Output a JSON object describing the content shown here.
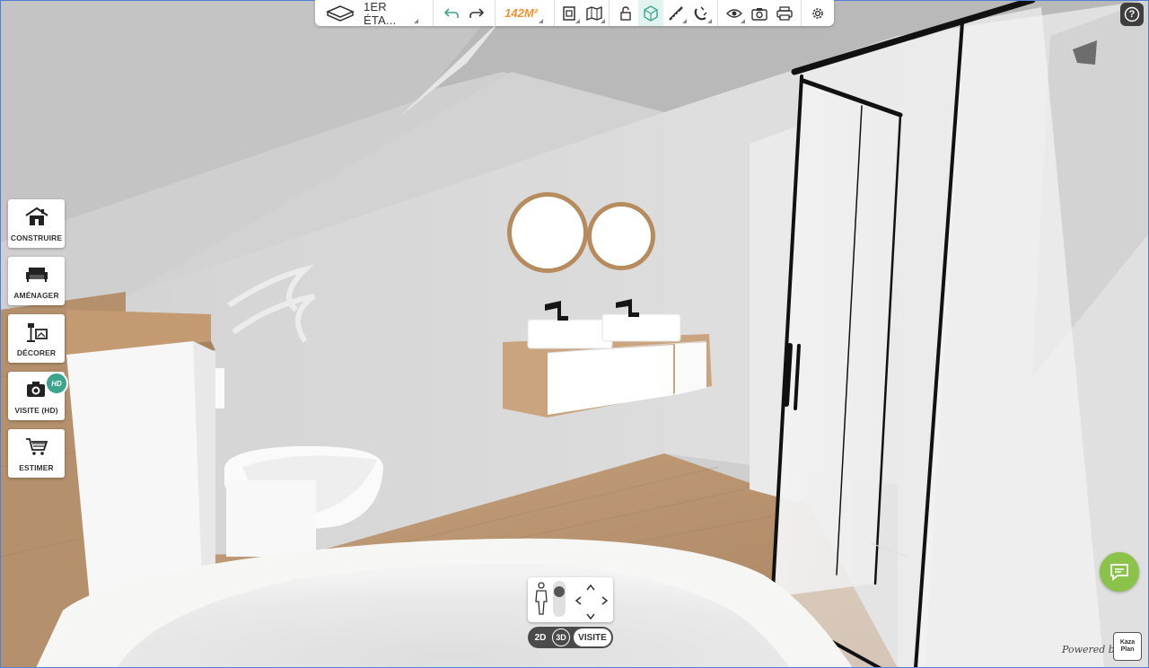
{
  "toolbar": {
    "floor_label": "1ER ÉTA...",
    "area_label": "142M²"
  },
  "sidebar": {
    "items": [
      {
        "label": "CONSTRUIRE",
        "icon": "house-icon"
      },
      {
        "label": "AMÉNAGER",
        "icon": "sofa-icon"
      },
      {
        "label": "DÉCORER",
        "icon": "lamp-frame-icon"
      },
      {
        "label": "VISITE (HD)",
        "icon": "camera-icon",
        "badge": "HD"
      },
      {
        "label": "ESTIMER",
        "icon": "cart-icon"
      }
    ]
  },
  "view_switch": {
    "option_2d": "2D",
    "option_3d": "3D",
    "option_visite": "VISITE",
    "selected": "VISITE"
  },
  "help_label": "?",
  "footer": {
    "powered_by": "Powered by",
    "logo_line1": "Kaza",
    "logo_line2": "Plan"
  },
  "colors": {
    "accent": "#3aa58c",
    "area": "#f0912f",
    "chat": "#8bc34a",
    "wood": "#b89170"
  }
}
